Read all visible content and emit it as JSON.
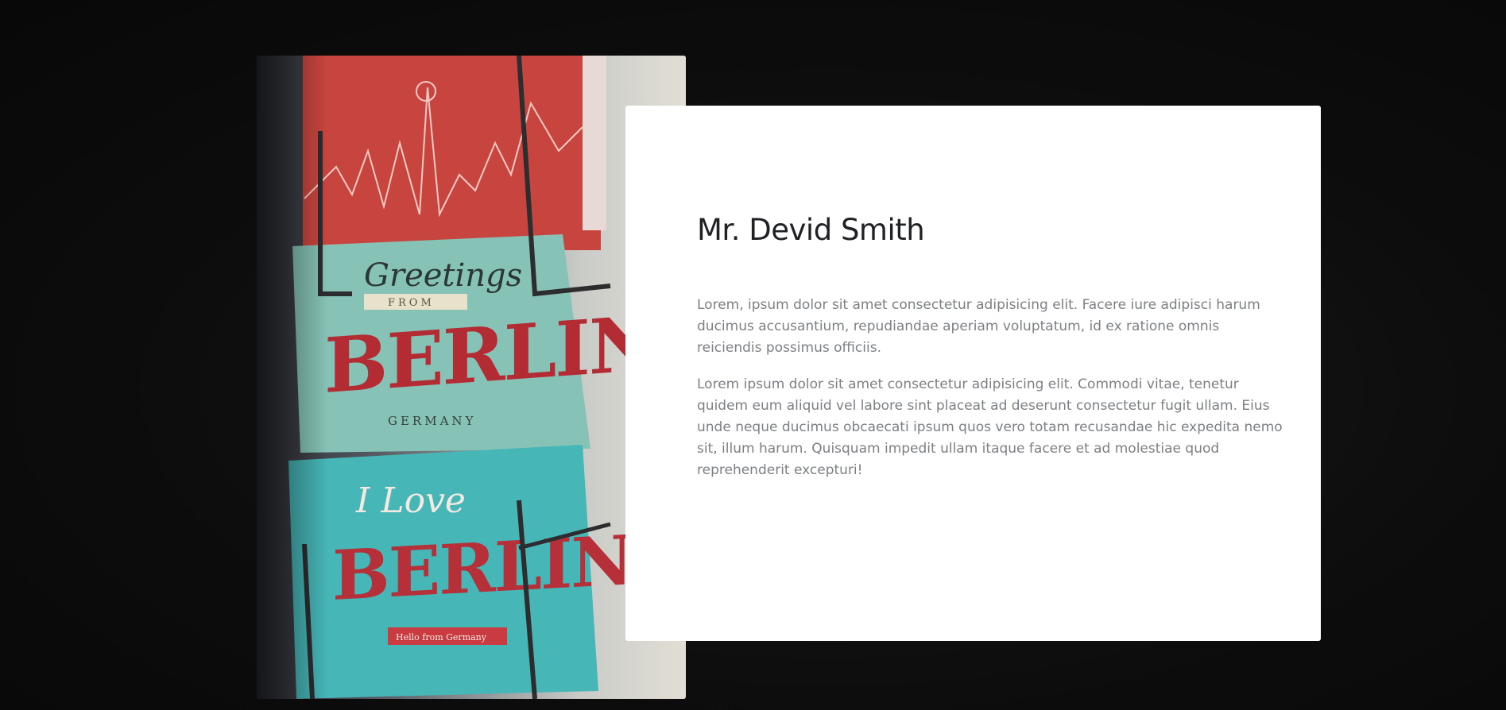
{
  "photo": {
    "cards": [
      {
        "top_line": "Greetings",
        "middle_line": "FROM",
        "main": "BERLIN",
        "bottom_line": "GERMANY"
      },
      {
        "top_line": "I Love",
        "main": "BERLIN",
        "bottom_line": "Hello from Germany"
      }
    ],
    "colors": {
      "red_card": "#c8453f",
      "teal_card": "#86c3b6",
      "teal_card_2": "#47b6b7",
      "wire": "#2d2d30"
    }
  },
  "profile": {
    "name": "Mr. Devid Smith",
    "paragraphs": [
      "Lorem, ipsum dolor sit amet consectetur adipisicing elit. Facere iure adipisci harum ducimus accusantium, repudiandae aperiam voluptatum, id ex ratione omnis reiciendis possimus officiis.",
      "Lorem ipsum dolor sit amet consectetur adipisicing elit. Commodi vitae, tenetur quidem eum aliquid vel labore sint placeat ad deserunt consectetur fugit ullam. Eius unde neque ducimus obcaecati ipsum quos vero totam recusandae hic expedita nemo sit, illum harum. Quisquam impedit ullam itaque facere et ad molestiae quod reprehenderit excepturi!"
    ]
  },
  "colors": {
    "background": "#0d0d0d",
    "card": "#ffffff",
    "heading": "#1f2124",
    "body_text": "#7c7f84"
  }
}
